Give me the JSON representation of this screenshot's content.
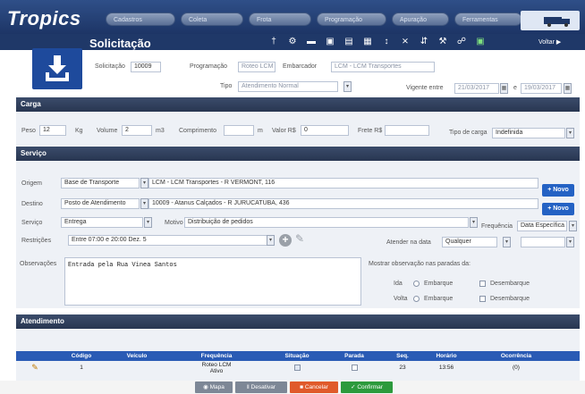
{
  "app": {
    "name": "Tropics"
  },
  "top_tabs": [
    "Cadastros",
    "Coleta",
    "Frota",
    "Programação",
    "Apuração",
    "Ferramentas"
  ],
  "page": {
    "title": "Solicitação",
    "back_label": "Voltar"
  },
  "header": {
    "solicitacao_label": "Solicitação",
    "solicitacao_value": "10009",
    "programacao_label": "Programação",
    "programacao_value": "Roteo LCM",
    "embarcador_label": "Embarcador",
    "embarcador_value": "LCM - LCM Transportes",
    "tipo_label": "Tipo",
    "tipo_value": "Atendimento Normal",
    "vigente_label": "Vigente entre",
    "vigente_from": "21/03/2017",
    "vigente_and": "e",
    "vigente_to": "19/03/2017"
  },
  "carga": {
    "section_title": "Carga",
    "peso_label": "Peso",
    "peso_value": "12",
    "peso_unit": "Kg",
    "volume_label": "Volume",
    "volume_value": "2",
    "volume_unit": "m3",
    "comprimento_label": "Comprimento",
    "comprimento_value": "",
    "comprimento_unit": "m",
    "valor_label": "Valor R$",
    "valor_value": "0",
    "frete_label": "Frete R$",
    "frete_value": "",
    "tipo_carga_label": "Tipo de carga",
    "tipo_carga_value": "Indefinida"
  },
  "servico": {
    "section_title": "Serviço",
    "origem_label": "Origem",
    "origem_type": "Base de Transporte",
    "origem_value": "LCM - LCM Transportes - R VERMONT, 116",
    "destino_label": "Destino",
    "destino_type": "Posto de Atendimento",
    "destino_value": "10009 - Atanus Calçados - R JURUCATUBA, 436",
    "novo_label": "+ Novo",
    "servico_label": "Serviço",
    "servico_value": "Entrega",
    "motivo_label": "Motivo",
    "motivo_value": "Distribuição de pedidos",
    "frequencia_label": "Frequência",
    "frequencia_value": "Data Específica",
    "restricoes_label": "Restrições",
    "restricoes_value": "Entre 07:00 e 20:00 Dez. 5",
    "atender_label": "Atender na data",
    "atender_value": "Qualquer",
    "observacoes_label": "Observações",
    "observacoes_value": "Entrada pela Rua Vinea Santos",
    "mostrar_label": "Mostrar observação nas paradas da:",
    "ida_label": "Ida",
    "volta_label": "Volta",
    "embarque_label": "Embarque",
    "desembarque_label": "Desembarque"
  },
  "atendimento": {
    "section_title": "Atendimento",
    "columns": [
      "Código",
      "Veículo",
      "Frequência",
      "Situação",
      "Parada",
      "Seq.",
      "Horário",
      "Ocorrência"
    ],
    "rows": [
      {
        "codigo": "1",
        "veiculo": "",
        "frequencia": "Roteo LCM",
        "frequencia2": "Ativo",
        "situacao": "",
        "parada": "",
        "seq": "23",
        "horario": "13:56",
        "ocorrencia": "(0)"
      }
    ]
  },
  "bottom_buttons": {
    "mapa": "Mapa",
    "desativar": "Desativar",
    "cancelar": "Cancelar",
    "confirmar": "Confirmar"
  },
  "colors": {
    "nav": "#1f3868",
    "accent": "#2462c4",
    "section": "#2f3c58",
    "cancel": "#e05a2a",
    "confirm": "#2c9a3c"
  }
}
